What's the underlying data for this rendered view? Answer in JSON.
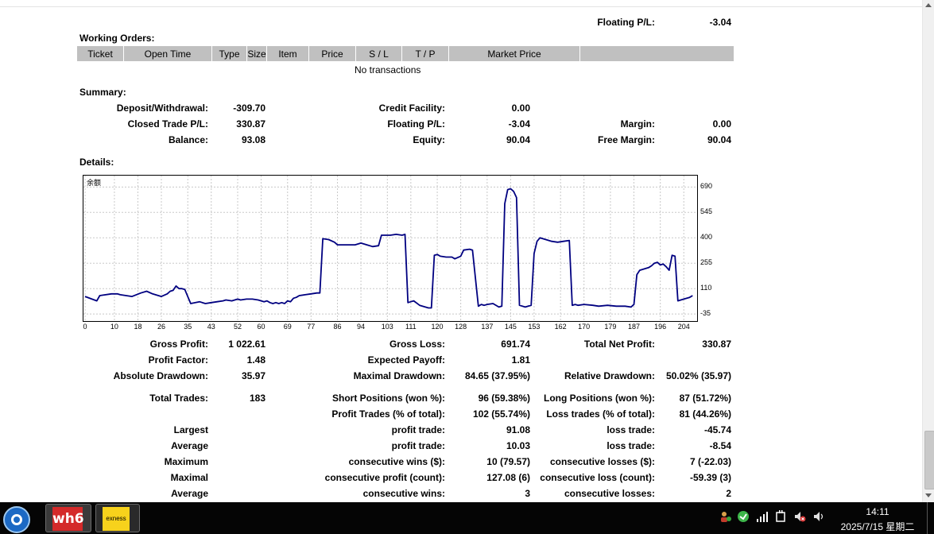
{
  "top_summary": {
    "floating_label": "Floating P/L:",
    "floating_value": "-3.04"
  },
  "working_orders": {
    "title": "Working Orders:",
    "columns": [
      "Ticket",
      "Open Time",
      "Type",
      "Size",
      "Item",
      "Price",
      "S / L",
      "T / P",
      "Market Price",
      ""
    ],
    "empty_text": "No transactions"
  },
  "summary": {
    "title": "Summary:",
    "deposit_label": "Deposit/Withdrawal:",
    "deposit_value": "-309.70",
    "closed_label": "Closed Trade P/L:",
    "closed_value": "330.87",
    "balance_label": "Balance:",
    "balance_value": "93.08",
    "credit_label": "Credit Facility:",
    "credit_value": "0.00",
    "floating_label": "Floating P/L:",
    "floating_value": "-3.04",
    "equity_label": "Equity:",
    "equity_value": "90.04",
    "margin_label": "Margin:",
    "margin_value": "0.00",
    "free_margin_label": "Free Margin:",
    "free_margin_value": "90.04"
  },
  "details": {
    "title": "Details:",
    "gross_profit_label": "Gross Profit:",
    "gross_profit_value": "1 022.61",
    "gross_loss_label": "Gross Loss:",
    "gross_loss_value": "691.74",
    "total_net_label": "Total Net Profit:",
    "total_net_value": "330.87",
    "profit_factor_label": "Profit Factor:",
    "profit_factor_value": "1.48",
    "expected_payoff_label": "Expected Payoff:",
    "expected_payoff_value": "1.81",
    "abs_dd_label": "Absolute Drawdown:",
    "abs_dd_value": "35.97",
    "max_dd_label": "Maximal Drawdown:",
    "max_dd_value": "84.65 (37.95%)",
    "rel_dd_label": "Relative Drawdown:",
    "rel_dd_value": "50.02% (35.97)",
    "total_trades_label": "Total Trades:",
    "total_trades_value": "183",
    "short_label": "Short Positions (won %):",
    "short_value": "96 (59.38%)",
    "long_label": "Long Positions (won %):",
    "long_value": "87 (51.72%)",
    "profit_trades_label": "Profit Trades (% of total):",
    "profit_trades_value": "102 (55.74%)",
    "loss_trades_label": "Loss trades (% of total):",
    "loss_trades_value": "81 (44.26%)",
    "largest_label": "Largest",
    "largest_profit_label": "profit trade:",
    "largest_profit_value": "91.08",
    "largest_loss_label": "loss trade:",
    "largest_loss_value": "-45.74",
    "average_label": "Average",
    "average_profit_label": "profit trade:",
    "average_profit_value": "10.03",
    "average_loss_label": "loss trade:",
    "average_loss_value": "-8.54",
    "maximum_label": "Maximum",
    "max_cons_wins_label": "consecutive wins ($):",
    "max_cons_wins_value": "10 (79.57)",
    "max_cons_losses_label": "consecutive losses ($):",
    "max_cons_losses_value": "7 (-22.03)",
    "maximal_label": "Maximal",
    "maximal_profit_label": "consecutive profit (count):",
    "maximal_profit_value": "127.08 (6)",
    "maximal_loss_label": "consecutive loss (count):",
    "maximal_loss_value": "-59.39 (3)",
    "average2_label": "Average",
    "avg_cons_wins_label": "consecutive wins:",
    "avg_cons_wins_value": "3",
    "avg_cons_losses_label": "consecutive losses:",
    "avg_cons_losses_value": "2"
  },
  "chart_data": {
    "type": "line",
    "legend": "余额",
    "line_color": "#000080",
    "grid": true,
    "x_ticks": [
      0,
      10,
      18,
      26,
      35,
      43,
      52,
      60,
      69,
      77,
      86,
      94,
      103,
      111,
      120,
      128,
      137,
      145,
      153,
      162,
      170,
      179,
      187,
      196,
      204
    ],
    "y_ticks": [
      690,
      545,
      400,
      255,
      110,
      -35
    ],
    "xlim": [
      0,
      208
    ],
    "ylim": [
      -75,
      755
    ],
    "x": [
      0,
      4,
      5,
      9,
      11,
      12,
      14,
      16,
      19,
      21,
      23,
      26,
      28,
      29,
      30,
      31,
      32,
      33,
      34,
      36,
      39,
      41,
      43,
      45,
      47,
      48,
      50,
      52,
      53,
      55,
      57,
      59,
      61,
      62,
      63,
      64,
      65,
      66,
      67,
      68,
      69,
      70,
      71,
      72,
      73,
      75,
      77,
      79,
      80,
      81,
      83,
      85,
      86,
      88,
      90,
      92,
      94,
      96,
      98,
      100,
      101,
      103,
      104,
      106,
      108,
      109,
      110,
      111,
      112,
      114,
      117,
      118,
      119,
      120,
      121,
      123,
      125,
      126,
      128,
      129,
      131,
      132,
      134,
      135,
      136,
      137,
      139,
      141,
      142,
      143,
      144,
      145,
      146,
      147,
      148,
      150,
      151,
      152,
      153,
      154,
      155,
      156,
      157,
      158,
      159,
      161,
      163,
      165,
      166,
      167,
      168,
      170,
      173,
      175,
      178,
      181,
      184,
      186,
      187,
      188,
      189,
      190,
      191,
      192,
      193,
      194,
      195,
      196,
      197,
      198,
      199,
      200,
      201,
      202,
      204,
      206,
      207
    ],
    "y": [
      65,
      40,
      70,
      80,
      80,
      75,
      70,
      65,
      85,
      95,
      80,
      65,
      80,
      95,
      100,
      125,
      110,
      110,
      105,
      25,
      35,
      25,
      30,
      35,
      40,
      45,
      40,
      50,
      45,
      50,
      50,
      45,
      35,
      40,
      30,
      25,
      30,
      25,
      30,
      25,
      40,
      35,
      55,
      60,
      70,
      75,
      80,
      85,
      85,
      395,
      390,
      375,
      360,
      360,
      360,
      360,
      370,
      360,
      350,
      355,
      415,
      415,
      415,
      420,
      415,
      420,
      30,
      35,
      40,
      15,
      0,
      0,
      300,
      305,
      295,
      290,
      290,
      280,
      295,
      330,
      335,
      330,
      10,
      20,
      15,
      20,
      25,
      5,
      10,
      595,
      675,
      680,
      665,
      630,
      15,
      5,
      10,
      15,
      310,
      380,
      400,
      395,
      390,
      385,
      380,
      375,
      380,
      385,
      15,
      20,
      15,
      20,
      15,
      10,
      15,
      10,
      10,
      5,
      20,
      190,
      215,
      220,
      225,
      230,
      240,
      255,
      260,
      245,
      250,
      235,
      215,
      300,
      295,
      40,
      50,
      60,
      70
    ]
  },
  "taskbar": {
    "app1_text": "wh6",
    "app2_text": "exness",
    "time": "14:11",
    "date": "2025/7/15 星期二"
  }
}
